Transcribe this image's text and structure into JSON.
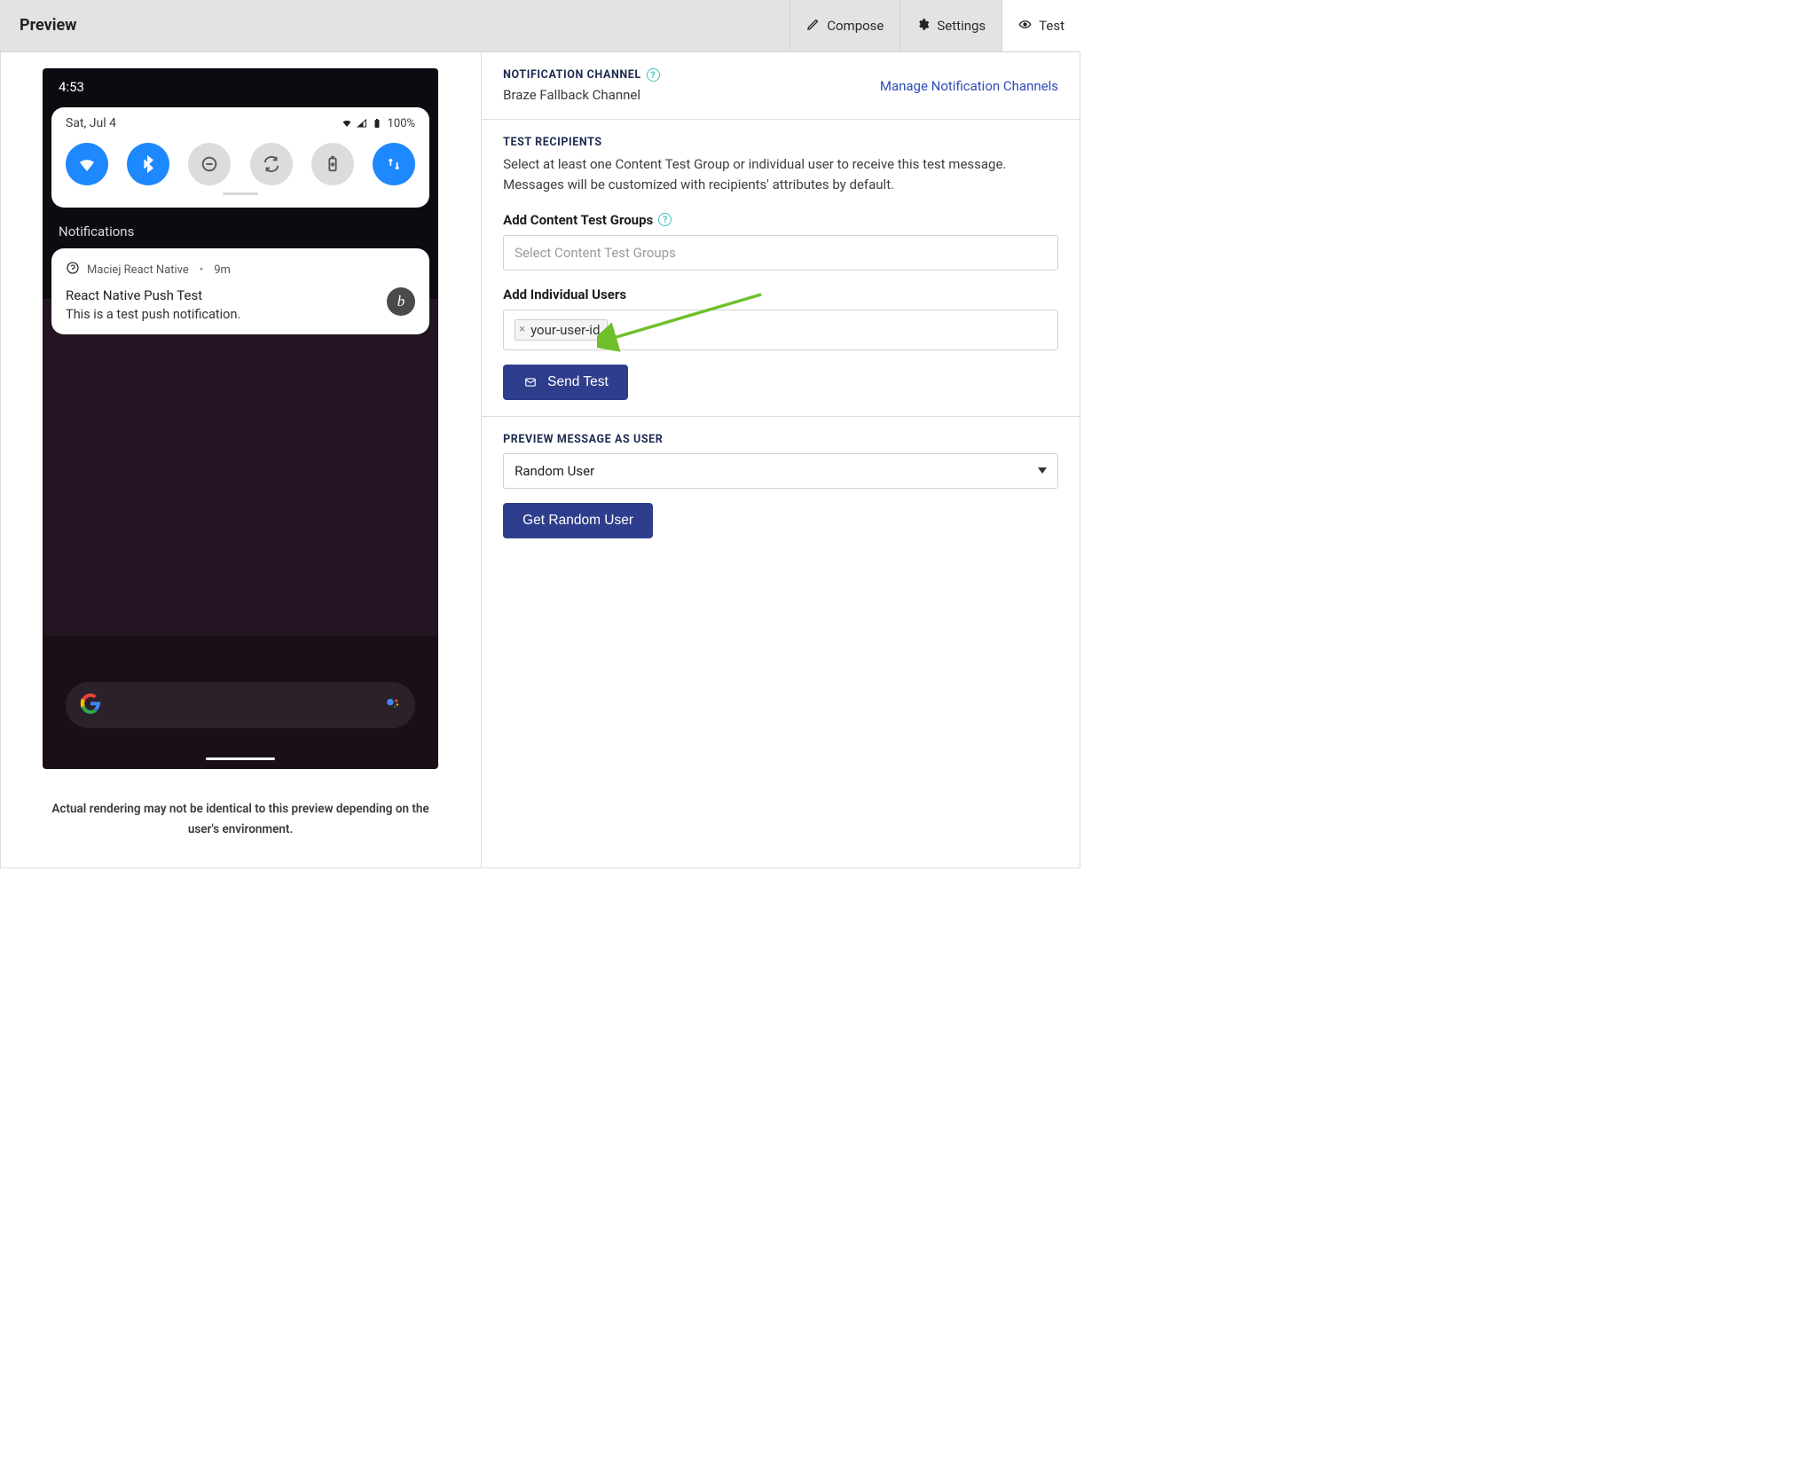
{
  "header": {
    "title": "Preview",
    "tabs": {
      "compose": "Compose",
      "settings": "Settings",
      "test": "Test"
    }
  },
  "phone": {
    "clock": "4:53",
    "date": "Sat, Jul 4",
    "battery": "100%",
    "notifications_label": "Notifications",
    "app_name": "Maciej React Native",
    "age": "9m",
    "title": "React Native Push Test",
    "body": "This is a test push notification.",
    "app_initial": "b"
  },
  "caption": "Actual rendering may not be identical to this preview depending on the user's environment.",
  "channel": {
    "heading": "Notification Channel",
    "value": "Braze Fallback Channel",
    "manage_link": "Manage Notification Channels"
  },
  "recipients": {
    "heading": "Test Recipients",
    "description": "Select at least one Content Test Group or individual user to receive this test message. Messages will be customized with recipients' attributes by default.",
    "groups_label": "Add Content Test Groups",
    "groups_placeholder": "Select Content Test Groups",
    "users_label": "Add Individual Users",
    "user_chip": "your-user-id",
    "send_button": "Send Test"
  },
  "preview_as": {
    "heading": "Preview Message As User",
    "selected": "Random User",
    "button": "Get Random User"
  }
}
